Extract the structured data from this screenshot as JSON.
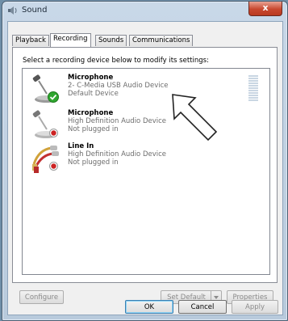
{
  "window": {
    "title": "Sound",
    "close_label": "x"
  },
  "tabs": [
    {
      "label": "Playback",
      "active": false
    },
    {
      "label": "Recording",
      "active": true
    },
    {
      "label": "Sounds",
      "active": false
    },
    {
      "label": "Communications",
      "active": false
    }
  ],
  "prompt": "Select a recording device below to modify its settings:",
  "devices": [
    {
      "name": "Microphone",
      "description": "2- C-Media USB Audio Device",
      "status": "Default Device",
      "icon": "microphone-icon",
      "badge": "green-check-icon"
    },
    {
      "name": "Microphone",
      "description": "High Definition Audio Device",
      "status": "Not plugged in",
      "icon": "microphone-icon",
      "badge": "red-down-arrow-icon"
    },
    {
      "name": "Line In",
      "description": "High Definition Audio Device",
      "status": "Not plugged in",
      "icon": "line-in-cable-icon",
      "badge": "red-down-arrow-icon"
    }
  ],
  "buttons": {
    "configure": "Configure",
    "set_default": "Set Default",
    "properties": "Properties",
    "ok": "OK",
    "cancel": "Cancel",
    "apply": "Apply"
  },
  "colors": {
    "accent": "#3c7fb1",
    "check_green": "#2fa62f",
    "status_red": "#cc2222"
  }
}
